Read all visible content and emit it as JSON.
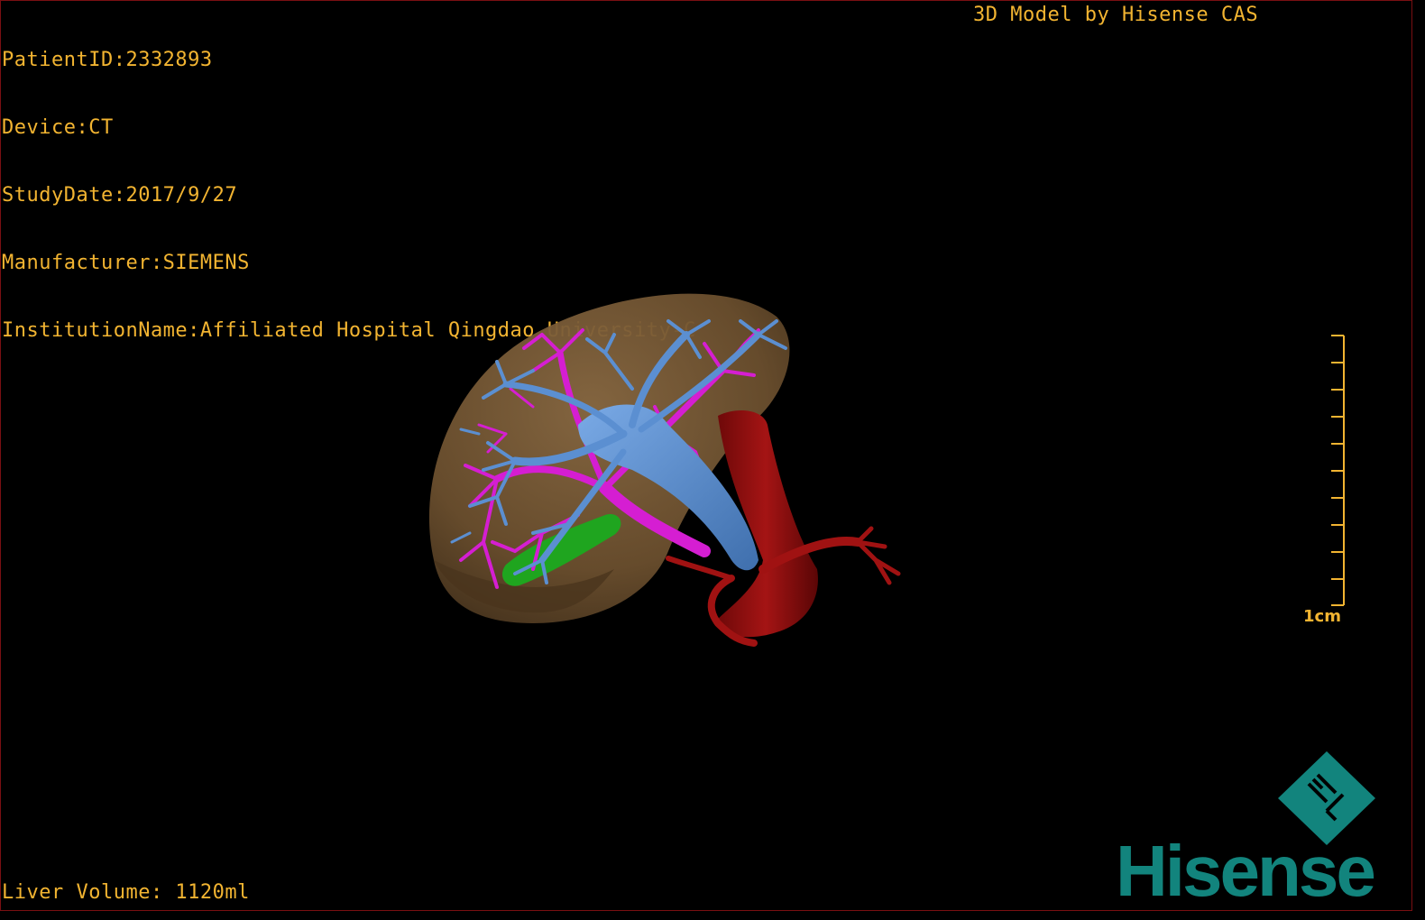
{
  "dicom_info": {
    "patient_id": "PatientID:2332893",
    "device": "Device:CT",
    "study_date": "StudyDate:2017/9/27",
    "manufacturer": "Manufacturer:SIEMENS",
    "institution": "InstitutionName:Affiliated Hospital Qingdao University-C"
  },
  "credit": "3D Model by Hisense CAS",
  "liver_volume": "Liver Volume: 1120ml",
  "scale": {
    "label": "1cm",
    "major_ticks": 1,
    "minor_ticks": 10
  },
  "logo": {
    "brand": "Hisense",
    "mark_letters": "HL"
  },
  "colors": {
    "overlay_text": "#f2b431",
    "liver": "#6b4f2e",
    "hepatic_vein": "#5b8fd1",
    "portal_vein": "#d51ed2",
    "artery": "#8e0f0f",
    "gallbladder": "#1fa51f",
    "logo": "#12847d",
    "frame": "#7a0f12"
  }
}
